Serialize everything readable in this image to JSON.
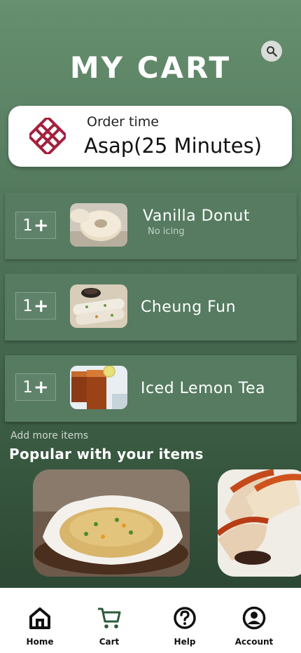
{
  "header": {
    "title": "MY CART",
    "search_icon": "search-icon"
  },
  "order": {
    "label": "Order time",
    "value": "Asap(25 Minutes)",
    "logo_icon": "knot-logo-icon",
    "logo_color": "#a3213d"
  },
  "cart": {
    "items": [
      {
        "qty": "1",
        "name": "Vanilla Donut",
        "note": "No icing",
        "image_icon": "donut-image"
      },
      {
        "qty": "1",
        "name": "Cheung Fun",
        "note": "",
        "image_icon": "cheung-fun-image"
      },
      {
        "qty": "1",
        "name": "Iced Lemon Tea",
        "note": "",
        "image_icon": "iced-lemon-tea-image"
      }
    ],
    "plus_icon": "plus-icon"
  },
  "popular": {
    "add_more_label": "Add more items",
    "title": "Popular with your items",
    "cards": [
      {
        "image_icon": "fried-rice-image"
      },
      {
        "image_icon": "roast-pork-image"
      }
    ]
  },
  "nav": {
    "items": [
      {
        "label": "Home",
        "icon": "home-icon"
      },
      {
        "label": "Cart",
        "icon": "cart-icon",
        "active": true
      },
      {
        "label": "Help",
        "icon": "help-icon"
      },
      {
        "label": "Account",
        "icon": "account-icon"
      }
    ],
    "active_color": "#2f5a3a"
  },
  "colors": {
    "background_top": "#66906f",
    "background_bottom": "#27402e",
    "item_card": "#567b61"
  }
}
